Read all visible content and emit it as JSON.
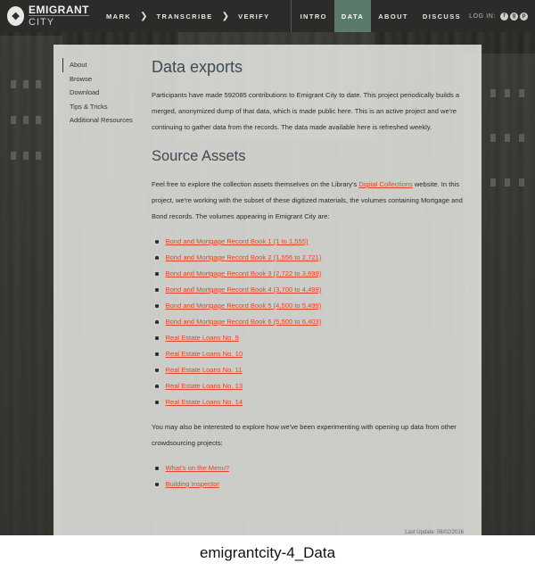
{
  "logo": {
    "mark_icon": "emigrant-city-logo",
    "line1": "EMIGRANT",
    "line2": "CITY"
  },
  "steps": [
    {
      "label": "MARK"
    },
    {
      "label": "TRANSCRIBE"
    },
    {
      "label": "VERIFY"
    }
  ],
  "nav": [
    {
      "label": "INTRO",
      "active": false
    },
    {
      "label": "DATA",
      "active": true
    },
    {
      "label": "ABOUT",
      "active": false
    },
    {
      "label": "DISCUSS",
      "active": false
    }
  ],
  "login": {
    "label": "LOG IN:",
    "providers": [
      "f",
      "g",
      "p"
    ]
  },
  "sidebar": {
    "items": [
      {
        "label": "About",
        "active": true
      },
      {
        "label": "Browse",
        "active": false
      },
      {
        "label": "Download",
        "active": false
      },
      {
        "label": "Tips & Tricks",
        "active": false
      },
      {
        "label": "Additional Resources",
        "active": false
      }
    ]
  },
  "content": {
    "title": "Data exports",
    "intro": "Participants have made 592085 contributions to Emigrant City to date. This project periodically builds a merged, anonymized dump of that data, which is made public here. This is an active project and we're continuing to gather data from the records. The data made available here is refreshed weekly.",
    "section_title": "Source Assets",
    "assets_text_before": "Feel free to explore the collection assets themselves on the Library's ",
    "assets_link": "Digital Collections",
    "assets_text_after": " website. In this project, we're working with the subset of these digitized materials, the volumes containing Mortgage and Bond records. The volumes appearing in Emigrant City are:",
    "assets": [
      "Bond and Mortgage Record Book 1 (1 to 1,555)",
      "Bond and Mortgage Record Book 2 (1,556 to 2,721)",
      "Bond and Mortgage Record Book 3 (2,722 to 3,699)",
      "Bond and Mortgage Record Book 4 (3,700 to 4,499)",
      "Bond and Mortgage Record Book 5 (4,500 to 5,499)",
      "Bond and Mortgage Record Book 6 (5,500 to 6,403)",
      "Real Estate Loans No. 9",
      "Real Estate Loans No. 10",
      "Real Estate Loans No. 11",
      "Real Estate Loans No. 13",
      "Real Estate Loans No. 14"
    ],
    "other_projects_text": "You may also be interested to explore how we've been experimenting with opening up data from other crowdsourcing projects:",
    "projects": [
      "What's on the Menu?",
      "Building Inspector"
    ],
    "last_update": "Last Update: 06/02/2016"
  },
  "caption": "emigrantcity-4_Data",
  "colors": {
    "accent": "#e0472a",
    "nav_bg": "#2b2b29",
    "active_nav": "#5a7a6a"
  }
}
